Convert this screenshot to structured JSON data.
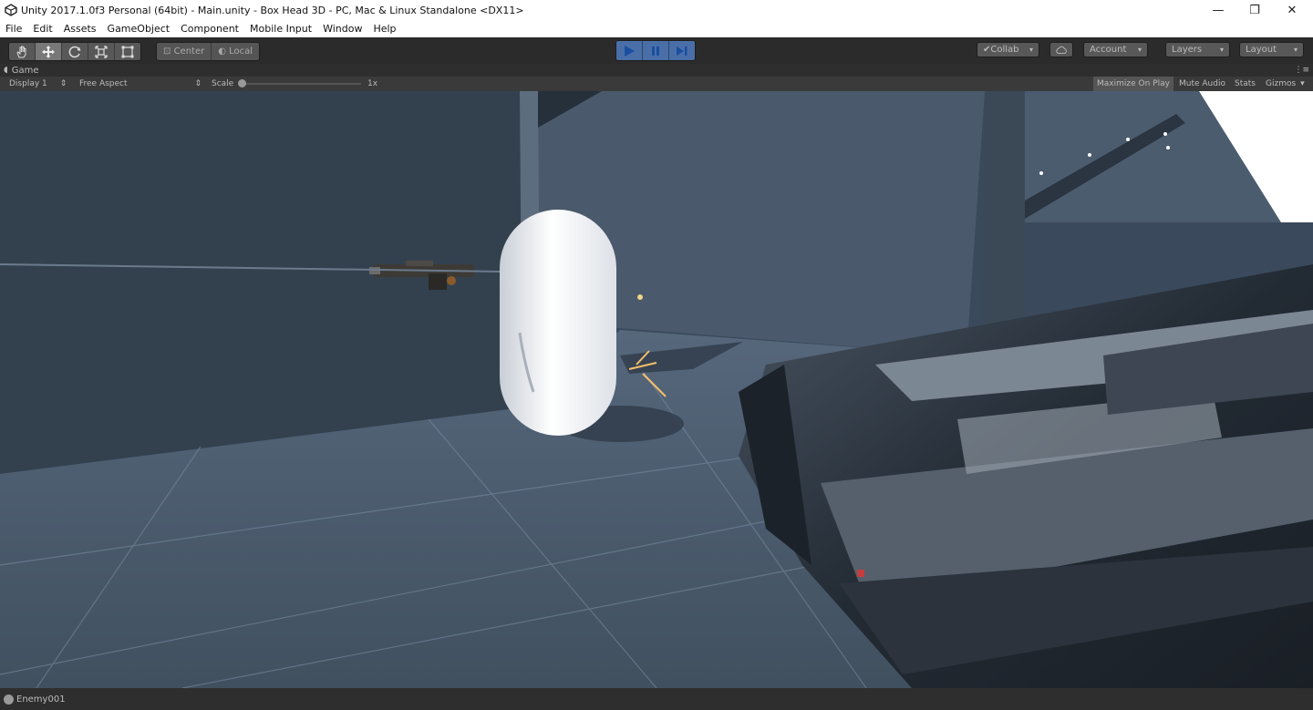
{
  "window": {
    "title": "Unity 2017.1.0f3 Personal (64bit) - Main.unity - Box Head 3D - PC, Mac & Linux Standalone <DX11>",
    "minimize_glyph": "—",
    "maximize_glyph": "❐",
    "close_glyph": "✕"
  },
  "menu": [
    "File",
    "Edit",
    "Assets",
    "GameObject",
    "Component",
    "Mobile Input",
    "Window",
    "Help"
  ],
  "toolbar": {
    "tools": [
      "hand-icon",
      "move-icon",
      "rotate-icon",
      "scale-icon",
      "rect-transform-icon"
    ],
    "active_tool": "move-icon",
    "pivot_label": "Center",
    "space_label": "Local",
    "collab_label": "Collab",
    "account_label": "Account",
    "layers_label": "Layers",
    "layout_label": "Layout"
  },
  "game_tab": {
    "label": "Game",
    "display": "Display 1",
    "aspect": "Free Aspect",
    "scale_label": "Scale",
    "scale_value": "1x",
    "maximize_on_play": "Maximize On Play",
    "mute_audio": "Mute Audio",
    "stats": "Stats",
    "gizmos": "Gizmos"
  },
  "status": {
    "message": "Enemy001"
  },
  "colors": {
    "play_accent": "#4a6fa8",
    "toolbar_bg": "#2b2b2b",
    "scene_floor": "#4d5d70",
    "scene_wall": "#33414f"
  }
}
